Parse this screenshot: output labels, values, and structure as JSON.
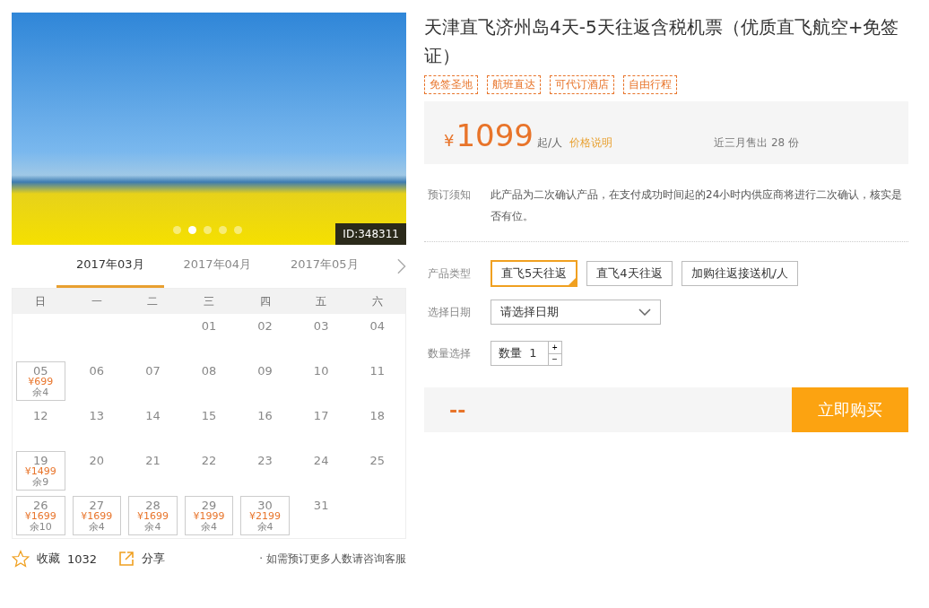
{
  "gallery": {
    "image_id": "ID:348311",
    "dots": [
      {
        "selected": false
      },
      {
        "selected": true
      },
      {
        "selected": false
      },
      {
        "selected": false
      },
      {
        "selected": false
      }
    ]
  },
  "calendar": {
    "months": [
      {
        "label": "2017年03月",
        "selected": true
      },
      {
        "label": "2017年04月",
        "selected": false
      },
      {
        "label": "2017年05月",
        "selected": false
      }
    ],
    "weekdays": [
      "日",
      "一",
      "二",
      "三",
      "四",
      "五",
      "六"
    ],
    "weeks": [
      [
        {
          "date": "01"
        },
        {
          "date": "02"
        },
        {
          "date": "03"
        },
        {
          "date": "04"
        }
      ],
      [
        {
          "date": "05",
          "price": "¥699",
          "remaining": "余4"
        },
        {
          "date": "06"
        },
        {
          "date": "07"
        },
        {
          "date": "08"
        },
        {
          "date": "09"
        },
        {
          "date": "10"
        },
        {
          "date": "11"
        }
      ],
      [
        {
          "date": "12"
        },
        {
          "date": "13"
        },
        {
          "date": "14"
        },
        {
          "date": "15"
        },
        {
          "date": "16"
        },
        {
          "date": "17"
        },
        {
          "date": "18"
        }
      ],
      [
        {
          "date": "19",
          "price": "¥1499",
          "remaining": "余9"
        },
        {
          "date": "20"
        },
        {
          "date": "21"
        },
        {
          "date": "22"
        },
        {
          "date": "23"
        },
        {
          "date": "24"
        },
        {
          "date": "25"
        }
      ],
      [
        {
          "date": "26",
          "price": "¥1699",
          "remaining": "余10"
        },
        {
          "date": "27",
          "price": "¥1699",
          "remaining": "余4"
        },
        {
          "date": "28",
          "price": "¥1699",
          "remaining": "余4"
        },
        {
          "date": "29",
          "price": "¥1999",
          "remaining": "余4"
        },
        {
          "date": "30",
          "price": "¥2199",
          "remaining": "余4"
        },
        {
          "date": "31"
        }
      ]
    ]
  },
  "footer": {
    "favorite_label": "收藏",
    "favorite_count": "1032",
    "share_label": "分享",
    "note": "· 如需预订更多人数请咨询客服"
  },
  "product": {
    "title": "天津直飞济州岛4天-5天往返含税机票（优质直飞航空+免签证）",
    "tags": [
      "免签圣地",
      "航班直达",
      "可代订酒店",
      "自由行程"
    ],
    "currency": "¥",
    "price": "1099",
    "price_unit": "起/人",
    "price_note": "价格说明",
    "sales": "近三月售出 28 份",
    "notice_label": "预订须知",
    "notice": "此产品为二次确认产品，在支付成功时间起的24小时内供应商将进行二次确认，核实是否有位。",
    "type_label": "产品类型",
    "types": [
      {
        "label": "直飞5天往返",
        "selected": true
      },
      {
        "label": "直飞4天往返",
        "selected": false
      },
      {
        "label": "加购往返接送机/人",
        "selected": false
      }
    ],
    "date_label": "选择日期",
    "date_placeholder": "请选择日期",
    "qty_label": "数量选择",
    "qty_prefix": "数量",
    "qty_value": "1",
    "qty_plus": "+",
    "qty_minus": "−",
    "total": "--",
    "buy": "立即购买"
  }
}
